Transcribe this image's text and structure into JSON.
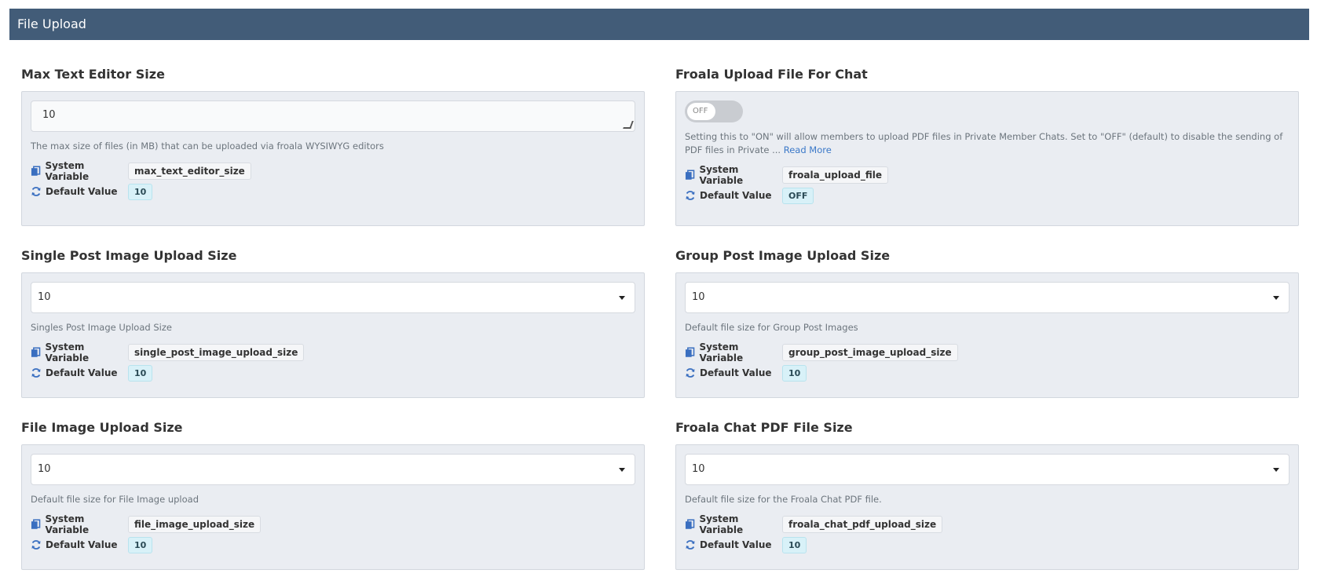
{
  "header": {
    "title": "File Upload"
  },
  "labels": {
    "system_variable": "System Variable",
    "default_value": "Default Value"
  },
  "sections": {
    "max_text": {
      "title": "Max Text Editor Size",
      "value": "10",
      "description": "The max size of files (in MB) that can be uploaded via froala WYSIWYG editors",
      "system_variable": "max_text_editor_size",
      "default_value": "10"
    },
    "froala_upload": {
      "title": "Froala Upload File For Chat",
      "toggle_state": "OFF",
      "description": "Setting this to \"ON\" will allow members to upload PDF files in Private Member Chats.  Set to \"OFF\" (default) to disable the sending of PDF files in Private ...",
      "read_more": "Read More",
      "system_variable": "froala_upload_file",
      "default_value": "OFF"
    },
    "single_post": {
      "title": "Single Post Image Upload Size",
      "value": "10",
      "description": "Singles Post Image Upload Size",
      "system_variable": "single_post_image_upload_size",
      "default_value": "10"
    },
    "group_post": {
      "title": "Group Post Image Upload Size",
      "value": "10",
      "description": "Default file size for Group Post Images",
      "system_variable": "group_post_image_upload_size",
      "default_value": "10"
    },
    "file_image": {
      "title": "File Image Upload Size",
      "value": "10",
      "description": "Default file size for File Image upload",
      "system_variable": "file_image_upload_size",
      "default_value": "10"
    },
    "froala_pdf": {
      "title": "Froala Chat PDF File Size",
      "value": "10",
      "description": "Default file size for the Froala Chat PDF file.",
      "system_variable": "froala_chat_pdf_upload_size",
      "default_value": "10"
    }
  },
  "colors": {
    "header_bg": "#425c78",
    "card_bg": "#eaedf2",
    "link": "#3a78c8",
    "icon": "#3a6fc0"
  }
}
